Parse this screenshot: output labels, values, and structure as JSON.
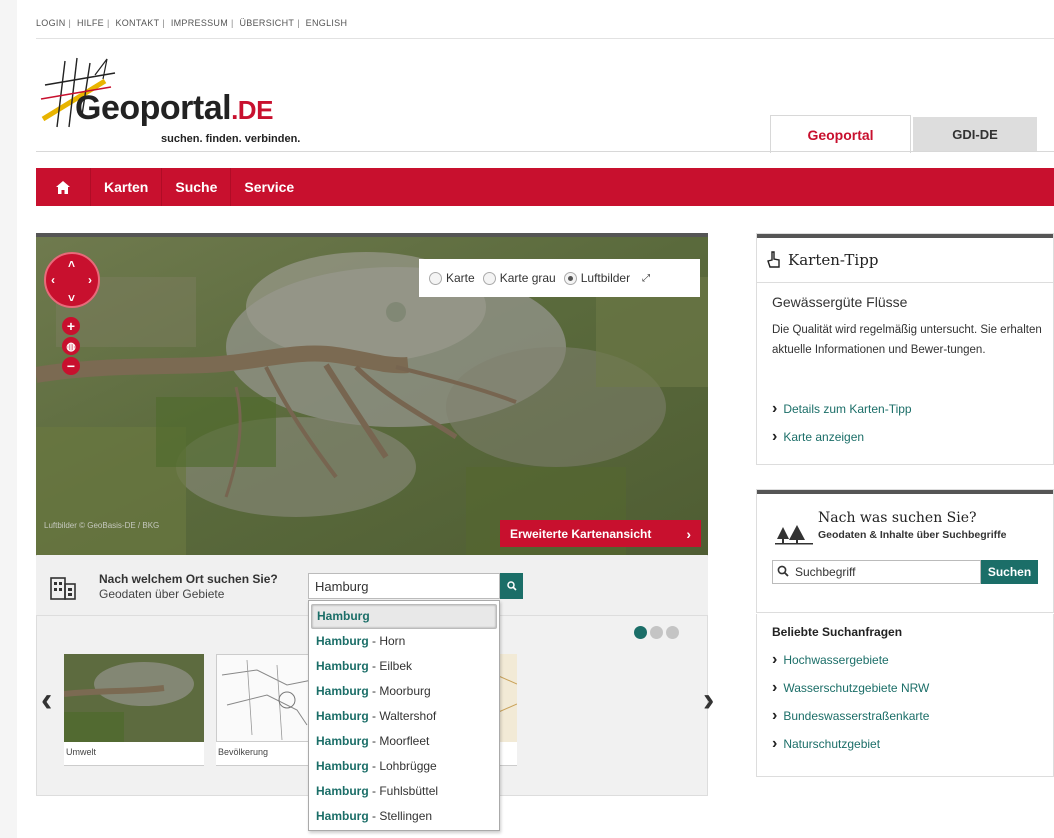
{
  "toplinks": [
    "LOGIN",
    "HILFE",
    "KONTAKT",
    "IMPRESSUM",
    "ÜBERSICHT",
    "ENGLISH"
  ],
  "logo": {
    "name": "Geoportal",
    "tld": ".DE",
    "tagline": "suchen. finden. verbinden."
  },
  "site_tabs": {
    "active": "Geoportal",
    "inactive": "GDI-DE"
  },
  "nav": {
    "home_icon": "home-icon",
    "items": [
      "Karten",
      "Suche",
      "Service"
    ]
  },
  "map": {
    "layers": [
      "Karte",
      "Karte grau",
      "Luftbilder"
    ],
    "selected_layer": "Luftbilder",
    "expanded_view_button": "Erweiterte Kartenansicht",
    "attribution": "Luftbilder © GeoBasis-DE / BKG"
  },
  "location_search": {
    "question": "Nach welchem Ort suchen Sie?",
    "subtitle": "Geodaten über Gebiete",
    "value": "Hamburg"
  },
  "suggestions": [
    {
      "bold": "Hamburg",
      "rest": ""
    },
    {
      "bold": "Hamburg",
      "rest": " - Horn"
    },
    {
      "bold": "Hamburg",
      "rest": " - Eilbek"
    },
    {
      "bold": "Hamburg",
      "rest": " - Moorburg"
    },
    {
      "bold": "Hamburg",
      "rest": " - Waltershof"
    },
    {
      "bold": "Hamburg",
      "rest": " - Moorfleet"
    },
    {
      "bold": "Hamburg",
      "rest": " - Lohbrügge"
    },
    {
      "bold": "Hamburg",
      "rest": " - Fuhlsbüttel"
    },
    {
      "bold": "Hamburg",
      "rest": " - Stellingen"
    }
  ],
  "carousel": {
    "captions": [
      "Umwelt",
      "Bevölkerung"
    ],
    "active_dot": 1
  },
  "tip": {
    "heading": "Karten-Tipp",
    "title": "Gewässergüte Flüsse",
    "text": "Die Qualität wird regelmäßig untersucht. Sie erhalten aktuelle Informationen und Bewer-tungen.",
    "links": [
      "Details zum Karten-Tipp",
      "Karte anzeigen"
    ]
  },
  "search": {
    "heading": "Nach was suchen Sie?",
    "subheading": "Geodaten & Inhalte über Suchbegriffe",
    "placeholder": "Suchbegriff",
    "button": "Suchen"
  },
  "popular": {
    "heading": "Beliebte Suchanfragen",
    "links": [
      "Hochwassergebiete",
      "Wasserschutzgebiete NRW",
      "Bundeswasserstraßenkarte",
      "Naturschutzgebiet"
    ]
  },
  "colors": {
    "brand_red": "#c8102e",
    "accent_teal": "#1b6e68"
  }
}
